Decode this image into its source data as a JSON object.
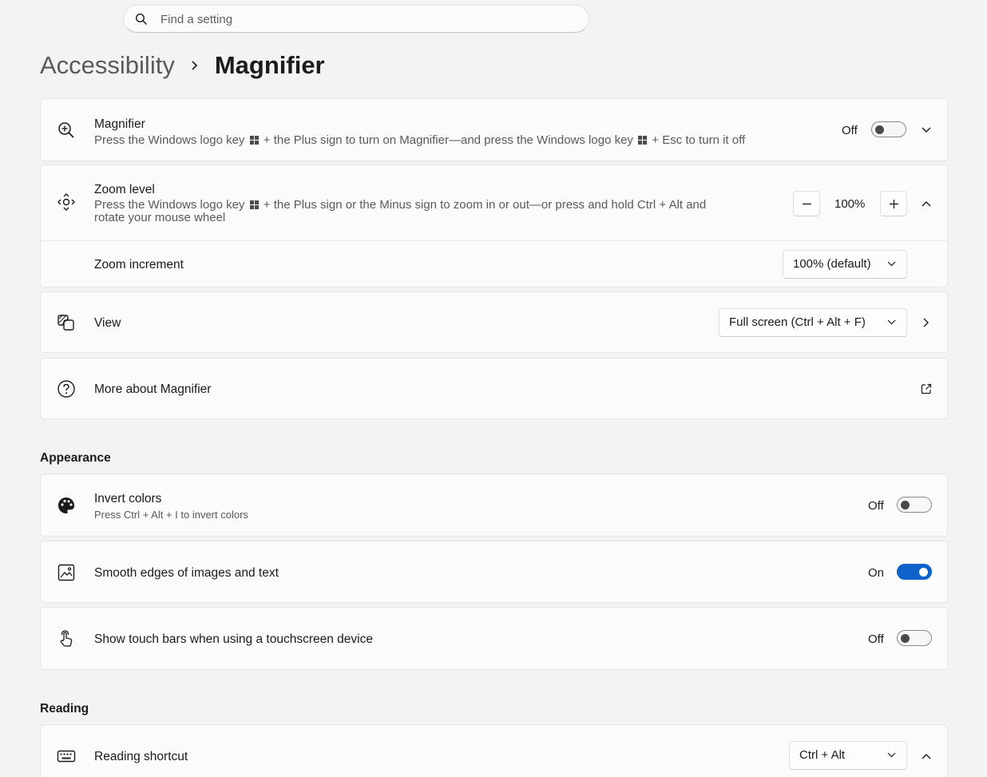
{
  "search": {
    "placeholder": "Find a setting",
    "icon": "search-icon"
  },
  "breadcrumb": {
    "parent": "Accessibility",
    "current": "Magnifier"
  },
  "magnifier": {
    "title": "Magnifier",
    "desc_a": "Press the Windows logo key",
    "desc_b": "+ the Plus sign to turn on Magnifier—and press the Windows logo key",
    "desc_c": "+ Esc to turn it off",
    "state": "Off",
    "toggle_on": false
  },
  "zoom_level": {
    "title": "Zoom level",
    "desc_a": "Press the Windows logo key",
    "desc_b": "+ the Plus sign or the Minus sign to zoom in or out—or press and hold Ctrl + Alt and",
    "desc_c": "rotate your mouse wheel",
    "value": "100%"
  },
  "zoom_increment": {
    "title": "Zoom increment",
    "value": "100% (default)"
  },
  "view": {
    "title": "View",
    "value": "Full screen (Ctrl + Alt + F)"
  },
  "more_about": {
    "title": "More about Magnifier"
  },
  "appearance": {
    "heading": "Appearance",
    "invert": {
      "title": "Invert colors",
      "desc": "Press Ctrl + Alt + I to invert colors",
      "state": "Off",
      "toggle_on": false
    },
    "smooth": {
      "title": "Smooth edges of images and text",
      "state": "On",
      "toggle_on": true
    },
    "touch": {
      "title": "Show touch bars when using a touchscreen device",
      "state": "Off",
      "toggle_on": false
    }
  },
  "reading": {
    "heading": "Reading",
    "shortcut": {
      "title": "Reading shortcut",
      "value": "Ctrl + Alt"
    }
  },
  "colors": {
    "accent": "#0f63c8",
    "background": "#f3f3f3",
    "card": "#fbfbfb"
  }
}
